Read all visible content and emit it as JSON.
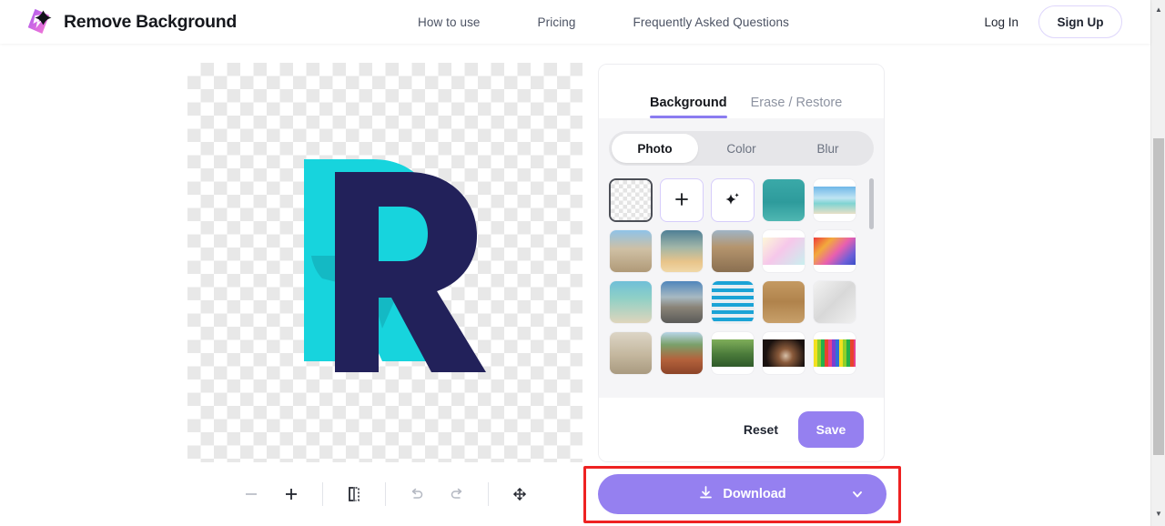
{
  "header": {
    "brand_name": "Remove Background",
    "logo_icon": "sparkle-gradient-logo",
    "nav": [
      {
        "label": "How to use"
      },
      {
        "label": "Pricing"
      },
      {
        "label": "Frequently Asked Questions"
      }
    ],
    "login_label": "Log In",
    "signup_label": "Sign Up"
  },
  "canvas": {
    "alt": "Letter R logo, navy R over cyan shape, transparent background",
    "background": "transparent-checkerboard"
  },
  "toolbar": {
    "items": [
      {
        "name": "zoom-out-icon",
        "label": "Zoom out"
      },
      {
        "name": "zoom-in-icon",
        "label": "Zoom in"
      },
      {
        "name": "compare-split-icon",
        "label": "Compare"
      },
      {
        "name": "undo-icon",
        "label": "Undo"
      },
      {
        "name": "redo-icon",
        "label": "Redo"
      },
      {
        "name": "fit-to-screen-icon",
        "label": "Fit to screen"
      }
    ]
  },
  "panel": {
    "tabs": [
      {
        "label": "Background",
        "active": true
      },
      {
        "label": "Erase / Restore",
        "active": false
      }
    ],
    "segmented": [
      {
        "label": "Photo",
        "active": true
      },
      {
        "label": "Color",
        "active": false
      },
      {
        "label": "Blur",
        "active": false
      }
    ],
    "thumbnails": [
      {
        "name": "transparent-background",
        "kind": "checker",
        "selected": true
      },
      {
        "name": "upload-background",
        "kind": "glyph",
        "glyph": "+"
      },
      {
        "name": "ai-background",
        "kind": "glyph",
        "glyph": "sparkle"
      },
      {
        "name": "teal-palm-trees",
        "kind": "fill",
        "css": "linear-gradient(180deg,#3aa9a8 0%,#2e9b9c 55%,#4fb7b2 100%)"
      },
      {
        "name": "tropical-beach",
        "kind": "letterbox",
        "css": "linear-gradient(180deg,#6fb7e8 0%,#bfe4f3 42%,#7fd4d2 62%,#e8dfc8 100%)"
      },
      {
        "name": "ancient-ruins",
        "kind": "fill",
        "css": "linear-gradient(180deg,#8fc3e8 0%,#cfc0a4 45%,#b09a78 100%)"
      },
      {
        "name": "sunset-clouds",
        "kind": "fill",
        "css": "linear-gradient(180deg,#4e7f95 0%,#9fb5a8 40%,#e8c48a 75%,#f0d8a8 100%)"
      },
      {
        "name": "colosseum",
        "kind": "fill",
        "css": "linear-gradient(180deg,#9fb4c6 0%,#b5956e 40%,#8a6f50 100%)"
      },
      {
        "name": "pastel-gradient",
        "kind": "letterbox",
        "css": "linear-gradient(135deg,#fdf7d8 0%,#f6c7ea 45%,#c9f0ef 100%)"
      },
      {
        "name": "rainbow-gradient",
        "kind": "letterbox",
        "css": "linear-gradient(135deg,#ee3b3b 0%,#f2a93c 28%,#e85fb0 55%,#6f5fd8 80%,#3a4fc8 100%)"
      },
      {
        "name": "beach-palms",
        "kind": "fill",
        "css": "linear-gradient(180deg,#6fbfd8 0%,#8fd0c6 40%,#dfd5bc 100%)"
      },
      {
        "name": "desert-road",
        "kind": "fill",
        "css": "linear-gradient(180deg,#4f86bb 0%,#a7b9c2 38%,#8a8478 62%,#5a5a58 100%)"
      },
      {
        "name": "blue-building-facade",
        "kind": "fill",
        "css": "repeating-linear-gradient(180deg,#1ba3d6 0px,#1ba3d6 4px,#e8eef2 4px,#e8eef2 8px)"
      },
      {
        "name": "wood-planks",
        "kind": "fill",
        "css": "linear-gradient(180deg,#c49a62 0%,#b0834c 50%,#c8a06a 100%)"
      },
      {
        "name": "white-architecture",
        "kind": "fill",
        "css": "linear-gradient(135deg,#f2f2f2 0%,#d8d8d8 50%,#efefef 100%)"
      },
      {
        "name": "stone-archway",
        "kind": "fill",
        "css": "linear-gradient(180deg,#dcd5c6 0%,#c4b79e 55%,#a99a80 100%)"
      },
      {
        "name": "red-canyon",
        "kind": "fill",
        "css": "linear-gradient(180deg,#b8d5e8 0%,#7aa06a 30%,#b4623c 65%,#8c4428 100%)"
      },
      {
        "name": "tropical-plants",
        "kind": "letterbox",
        "css": "linear-gradient(180deg,#7fae5a 0%,#4a7a3a 55%,#2f5a2a 100%)"
      },
      {
        "name": "dark-portrait",
        "kind": "letterbox",
        "css": "radial-gradient(circle at 55% 60%, #d8c0a8 0%, #8a5a3a 25%, #1a1210 70%)"
      },
      {
        "name": "color-stripes",
        "kind": "letterbox",
        "css": "repeating-linear-gradient(90deg,#f2e020 0px,#f2e020 4px,#8fd02a 4px,#8fd02a 8px,#24b04a 8px,#24b04a 12px,#e8432c 12px,#e8432c 16px,#e83f8e 16px,#e83f8e 20px,#7a3fd0 20px,#7a3fd0 24px,#2f6fd8 24px,#2f6fd8 28px)"
      }
    ],
    "reset_label": "Reset",
    "save_label": "Save"
  },
  "download": {
    "label": "Download",
    "download_icon": "download-icon",
    "chevron_icon": "chevron-down-icon",
    "highlight_color": "#ee2222"
  },
  "colors": {
    "accent_purple": "#9580f0",
    "tab_underline": "#8b7cf0",
    "artwork_cyan": "#17d4dd",
    "artwork_navy": "#22215a"
  }
}
